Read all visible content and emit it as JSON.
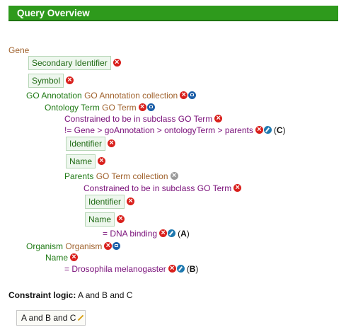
{
  "header": {
    "title": "Query Overview"
  },
  "tree": {
    "root": "Gene",
    "secondary_identifier": "Secondary Identifier",
    "symbol": "Symbol",
    "go_annotation": {
      "field": "GO Annotation",
      "type": "GO Annotation",
      "collection": "collection"
    },
    "ontology_term": {
      "field": "Ontology Term",
      "type": "GO Term"
    },
    "ot_constraint_subclass": {
      "text": "Constrained to be in subclass",
      "type": "GO Term"
    },
    "ot_constraint_path": {
      "text": "!= Gene > goAnnotation > ontologyTerm > parents",
      "code": "C"
    },
    "ot_identifier": "Identifier",
    "ot_name": "Name",
    "parents": {
      "field": "Parents",
      "type": "GO Term",
      "collection": "collection"
    },
    "parents_constraint_subclass": {
      "text": "Constrained to be in subclass",
      "type": "GO Term"
    },
    "parents_identifier": "Identifier",
    "parents_name": "Name",
    "parents_name_constraint": {
      "text": "= DNA binding",
      "code": "A"
    },
    "organism": {
      "field": "Organism",
      "type": "Organism"
    },
    "organism_name": "Name",
    "organism_name_constraint": {
      "text": "= Drosophila melanogaster",
      "code": "B"
    }
  },
  "constraint_logic": {
    "label": "Constraint logic:",
    "value": "A and B and C",
    "editor_value": "A and B and C"
  },
  "icons": {
    "remove": "remove-icon",
    "join": "join-style-icon",
    "edit": "edit-pencil-icon",
    "disabled_remove": "disabled-remove-icon"
  },
  "colors": {
    "header_bg": "#2e9a1c",
    "field": "#1f7a14",
    "type": "#a0622d",
    "constraint": "#7a107a",
    "remove": "#d9201c"
  }
}
